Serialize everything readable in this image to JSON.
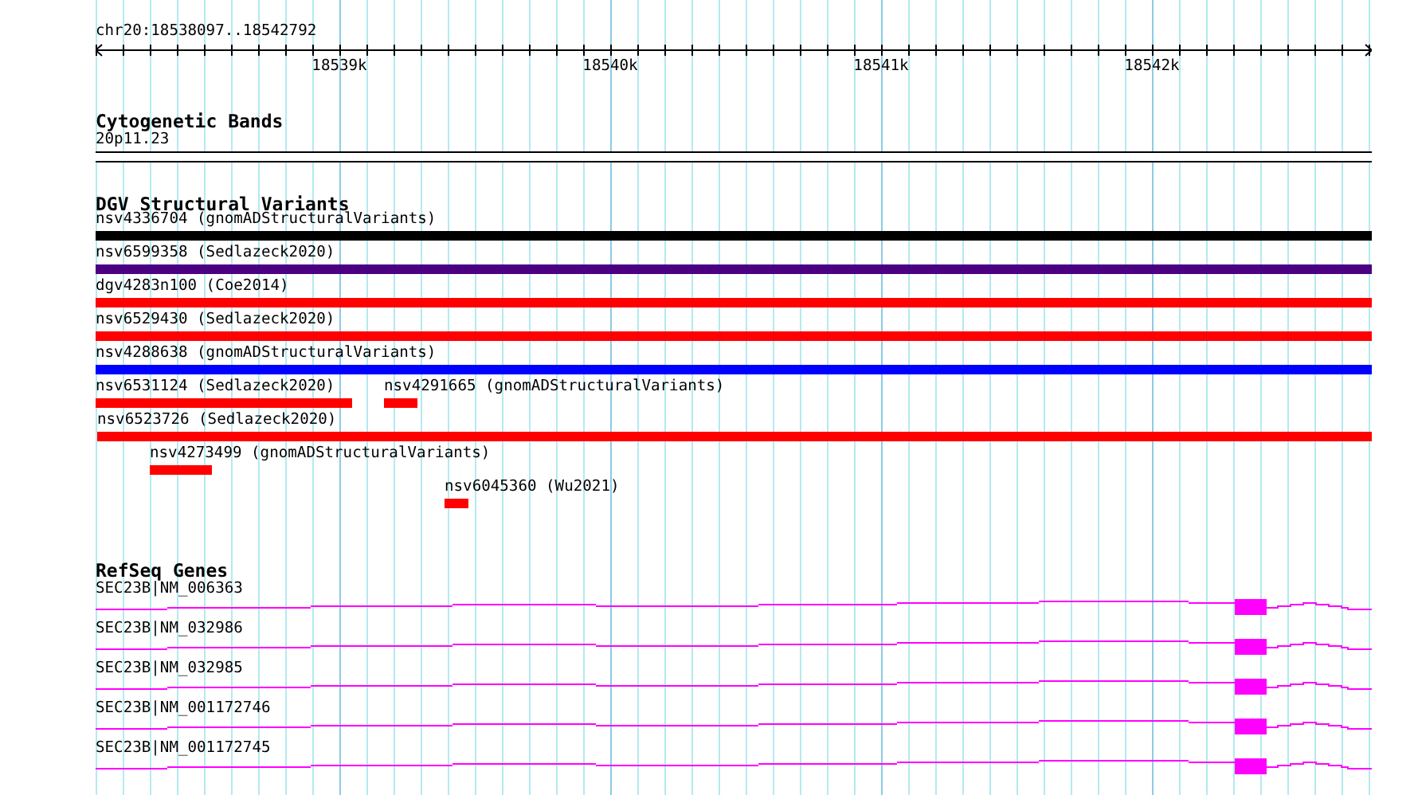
{
  "ruler": {
    "location": "chr20:18538097..18542792",
    "ticks": [
      "18539k",
      "18540k",
      "18541k",
      "18542k"
    ]
  },
  "cytogenetic_bands": {
    "title": "Cytogenetic Bands",
    "band": "20p11.23"
  },
  "dgv_structural_variants": {
    "title": "DGV Structural Variants",
    "rows": [
      {
        "features": [
          {
            "label": "nsv4336704 (gnomADStructuralVariants)",
            "color": "#000000"
          }
        ]
      },
      {
        "features": [
          {
            "label": "nsv6599358 (Sedlazeck2020)",
            "color": "#4b0082"
          }
        ]
      },
      {
        "features": [
          {
            "label": "dgv4283n100 (Coe2014)",
            "color": "#ff0000"
          }
        ]
      },
      {
        "features": [
          {
            "label": "nsv6529430 (Sedlazeck2020)",
            "color": "#ff0000"
          }
        ]
      },
      {
        "features": [
          {
            "label": "nsv4288638 (gnomADStructuralVariants)",
            "color": "#0000ff"
          }
        ]
      },
      {
        "features": [
          {
            "label": "nsv6531124 (Sedlazeck2020)",
            "color": "#ff0000"
          },
          {
            "label": "nsv4291665 (gnomADStructuralVariants)",
            "color": "#ff0000"
          }
        ]
      },
      {
        "features": [
          {
            "label": "nsv6523726 (Sedlazeck2020)",
            "color": "#ff0000"
          }
        ]
      },
      {
        "features": [
          {
            "label": "nsv4273499 (gnomADStructuralVariants)",
            "color": "#ff0000"
          }
        ]
      },
      {
        "features": [
          {
            "label": "nsv6045360 (Wu2021)",
            "color": "#ff0000"
          }
        ]
      }
    ]
  },
  "refseq_genes": {
    "title": "RefSeq Genes",
    "genes": [
      {
        "label": "SEC23B|NM_006363"
      },
      {
        "label": "SEC23B|NM_032986"
      },
      {
        "label": "SEC23B|NM_032985"
      },
      {
        "label": "SEC23B|NM_001172746"
      },
      {
        "label": "SEC23B|NM_001172745"
      }
    ]
  }
}
